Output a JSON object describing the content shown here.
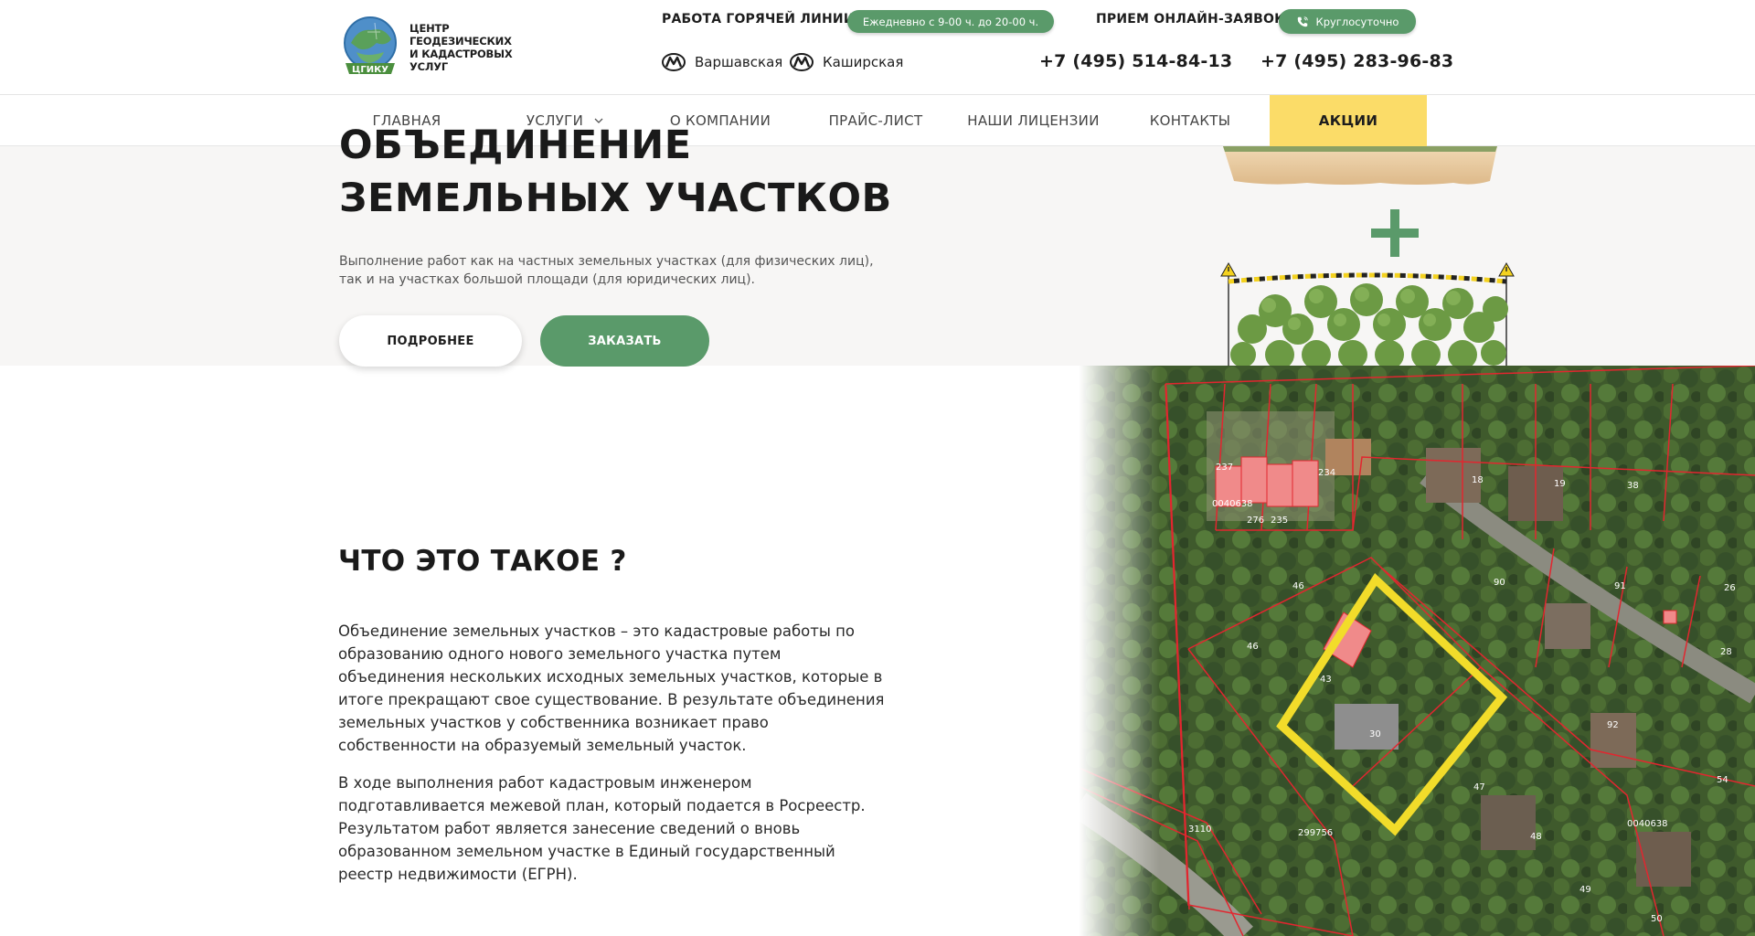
{
  "header": {
    "logo_line1": "ЦЕНТР ГЕОДЕЗИЧЕСКИХ",
    "logo_line2": "И КАДАСТРОВЫХ УСЛУГ",
    "logo_badge": "ЦГИКУ",
    "hotline_label": "РАБОТА ГОРЯЧЕЙ ЛИНИИ:",
    "hotline_hours": "Ежедневно с 9-00 ч. до 20-00 ч.",
    "online_label": "ПРИЕМ ОНЛАЙН-ЗАЯВОК:",
    "online_hours": "Круглосуточно",
    "metro": [
      "Варшавская",
      "Каширская"
    ],
    "phones": [
      "+7 (495) 514-84-13",
      "+7 (495) 283-96-83"
    ],
    "accent_color": "#5a9a6a"
  },
  "nav": {
    "items": [
      {
        "label": "ГЛАВНАЯ"
      },
      {
        "label": "УСЛУГИ"
      },
      {
        "label": "О КОМПАНИИ"
      },
      {
        "label": "ПРАЙС-ЛИСТ"
      },
      {
        "label": "НАШИ ЛИЦЕНЗИИ"
      },
      {
        "label": "КОНТАКТЫ"
      },
      {
        "label": "АКЦИИ"
      }
    ],
    "promo_color": "#fbdc68"
  },
  "hero": {
    "title_line1": "ОБЪЕДИНЕНИЕ",
    "title_line2": "ЗЕМЕЛЬНЫХ УЧАСТКОВ",
    "description": "Выполнение работ как на частных земельных участках (для физических лиц), так и на участках большой площади (для юридических лиц).",
    "more_button": "ПОДРОБНЕЕ",
    "order_button": "ЗАКАЗАТЬ"
  },
  "map": {
    "labels": [
      "237",
      "234",
      "0040638",
      "276",
      "235",
      "18",
      "19",
      "38",
      "46",
      "90",
      "91",
      "26",
      "46",
      "43",
      "30",
      "92",
      "47",
      "54",
      "299756",
      "48",
      "0040638",
      "3110",
      "49",
      "50",
      "28"
    ]
  },
  "content": {
    "title": "ЧТО ЭТО ТАКОЕ ?",
    "paragraph1": "Объединение земельных участков – это кадастровые работы по образованию одного нового земельного участка путем объединения нескольких исходных земельных участков, которые в итоге прекращают свое существование. В результате объединения земельных участков у собственника возникает право собственности на образуемый земельный участок.",
    "paragraph2": "В ходе выполнения работ кадастровым инженером подготавливается межевой план, который подается в Росреестр. Результатом работ является занесение сведений о вновь образованном земельном участке в Единый государственный реестр недвижимости (ЕГРН)."
  }
}
